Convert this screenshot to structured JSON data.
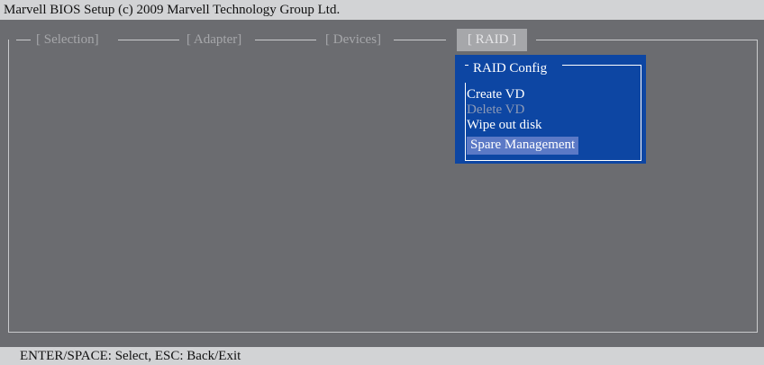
{
  "title": "Marvell BIOS Setup (c) 2009 Marvell Technology Group Ltd.",
  "menu": {
    "tabs": [
      {
        "label": "[ Selection]",
        "active": false
      },
      {
        "label": "[ Adapter]",
        "active": false
      },
      {
        "label": "[ Devices]",
        "active": false
      },
      {
        "label": "[  RAID  ]",
        "active": true
      }
    ]
  },
  "popup": {
    "title": "RAID Config",
    "items": [
      {
        "label": "Create VD",
        "state": "enabled"
      },
      {
        "label": "Delete VD",
        "state": "disabled"
      },
      {
        "label": "Wipe out disk",
        "state": "enabled"
      },
      {
        "label": "Spare Management",
        "state": "selected"
      }
    ]
  },
  "status": "ENTER/SPACE: Select, ESC: Back/Exit",
  "colors": {
    "background": "#6b6c70",
    "bar": "#d2d3d5",
    "popup": "#0d46a3",
    "highlight": "#5b79c6"
  }
}
